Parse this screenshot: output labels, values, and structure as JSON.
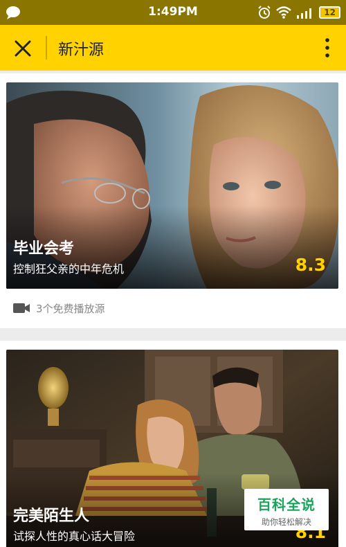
{
  "status_bar": {
    "time": "1:49PM",
    "battery": "12",
    "icons": [
      "message-icon",
      "alarm-icon",
      "wifi-icon",
      "signal-icon",
      "battery-icon"
    ]
  },
  "app_bar": {
    "title": "新汁源",
    "close_icon": "close-icon",
    "more_icon": "more-vert-icon",
    "background": "#ffd200"
  },
  "feed": {
    "items": [
      {
        "title": "毕业会考",
        "subtitle": "控制狂父亲的中年危机",
        "rating": "8.3",
        "sources": "3个免费播放源"
      },
      {
        "title": "完美陌生人",
        "subtitle": "试探人性的真心话大冒险",
        "rating": "8.1"
      }
    ]
  },
  "watermark": {
    "main": "百科全说",
    "sub": "助你轻松解决"
  },
  "colors": {
    "accent": "#ffd200",
    "rating": "#ffd200",
    "status_bar": "#8a7500",
    "muted_text": "#888888"
  }
}
